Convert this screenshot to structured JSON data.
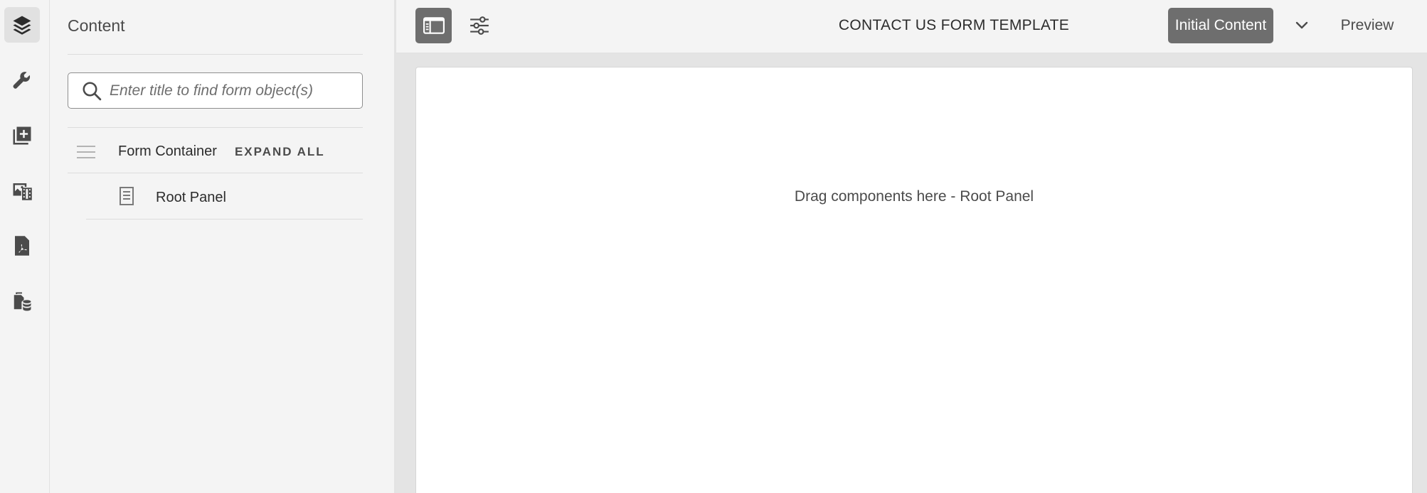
{
  "rail": {
    "items": [
      {
        "icon": "layers-icon",
        "name": "rail-content-tree",
        "active": true
      },
      {
        "icon": "wrench-icon",
        "name": "rail-properties",
        "active": false
      },
      {
        "icon": "add-component-icon",
        "name": "rail-components",
        "active": false
      },
      {
        "icon": "assets-icon",
        "name": "rail-assets",
        "active": false
      },
      {
        "icon": "pdf-icon",
        "name": "rail-document-of-record",
        "active": false
      },
      {
        "icon": "data-source-icon",
        "name": "rail-data-sources",
        "active": false
      }
    ]
  },
  "panel": {
    "title": "Content",
    "search_placeholder": "Enter title to find form object(s)",
    "tree": {
      "container_label": "Form Container",
      "expand_all_label": "EXPAND ALL",
      "children": [
        {
          "label": "Root Panel",
          "icon": "panel-icon"
        }
      ]
    }
  },
  "toolbar": {
    "title": "CONTACT US FORM TEMPLATE",
    "mode_button_label": "Initial Content",
    "preview_label": "Preview"
  },
  "canvas": {
    "drop_zone_text": "Drag components here - Root Panel"
  }
}
